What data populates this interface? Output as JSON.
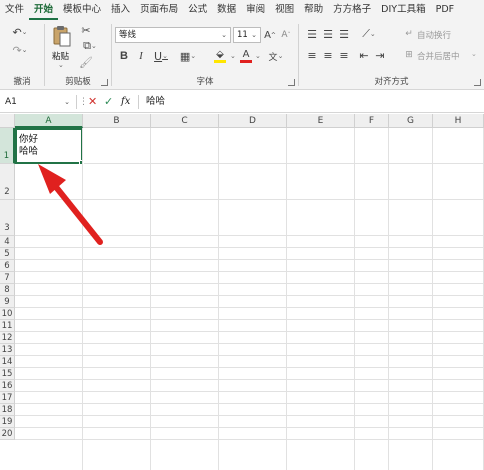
{
  "menu": {
    "items": [
      "文件",
      "开始",
      "模板中心",
      "插入",
      "页面布局",
      "公式",
      "数据",
      "审阅",
      "视图",
      "帮助",
      "方方格子",
      "DIY工具箱",
      "PDF"
    ],
    "active_index": 1
  },
  "ribbon": {
    "undo_group_label": "撤消",
    "clipboard": {
      "paste_label": "粘贴",
      "group_label": "剪贴板"
    },
    "font": {
      "font_name": "等线",
      "font_size": "11",
      "group_label": "字体"
    },
    "alignment": {
      "wrap_text_label": "自动换行",
      "merge_center_label": "合并后居中",
      "group_label": "对齐方式"
    }
  },
  "formula_bar": {
    "name_box": "A1",
    "fx_label": "fx",
    "formula": "哈哈"
  },
  "grid": {
    "columns": [
      "A",
      "B",
      "C",
      "D",
      "E",
      "F",
      "G",
      "H"
    ],
    "rows": [
      "1",
      "2",
      "3",
      "4",
      "5",
      "6",
      "7",
      "8",
      "9",
      "10",
      "11",
      "12",
      "13",
      "14",
      "15",
      "16",
      "17",
      "18",
      "19",
      "20"
    ],
    "cell_a1_lines": [
      "你好",
      "哈哈"
    ]
  },
  "colors": {
    "accent": "#217346",
    "arrow": "#e0211f",
    "font_color_bar": "#e0211f",
    "fill_color_bar": "#ffe600"
  }
}
